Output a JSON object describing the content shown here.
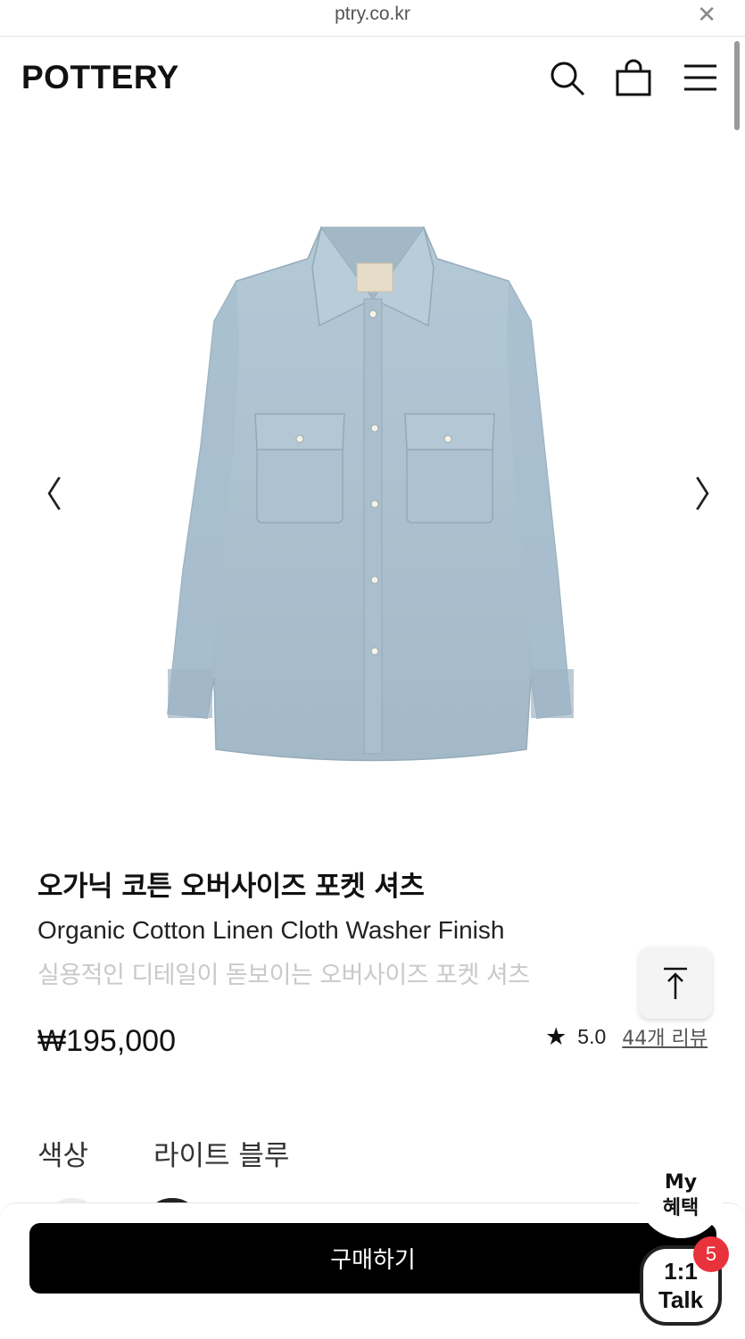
{
  "browser": {
    "url": "ptry.co.kr",
    "close_glyph": "✕"
  },
  "header": {
    "logo": "POTTERY",
    "icons": [
      "search-icon",
      "shopping-bag-icon",
      "menu-icon"
    ]
  },
  "gallery": {
    "prev_glyph": "〈",
    "next_glyph": "〉",
    "image_icon": "shirt-image"
  },
  "product": {
    "title_ko": "오가닉 코튼 오버사이즈 포켓 셔츠",
    "title_en": "Organic Cotton Linen Cloth Washer Finish",
    "subtitle": "실용적인 디테일이 돋보이는 오버사이즈 포켓 셔츠",
    "price": "₩195,000",
    "rating": "5.0",
    "reviews": "44개 리뷰"
  },
  "options": {
    "color_label": "색상",
    "color_value": "라이트 블루"
  },
  "actions": {
    "buy_label": "구매하기",
    "my_benefit_line1": "My",
    "my_benefit_line2": "혜택",
    "talk_line1": "1:1",
    "talk_line2": "Talk",
    "talk_badge": "5"
  },
  "colors": {
    "shirt": "#a9bfcd",
    "buy_bg": "#000000",
    "badge": "#e8323c"
  }
}
